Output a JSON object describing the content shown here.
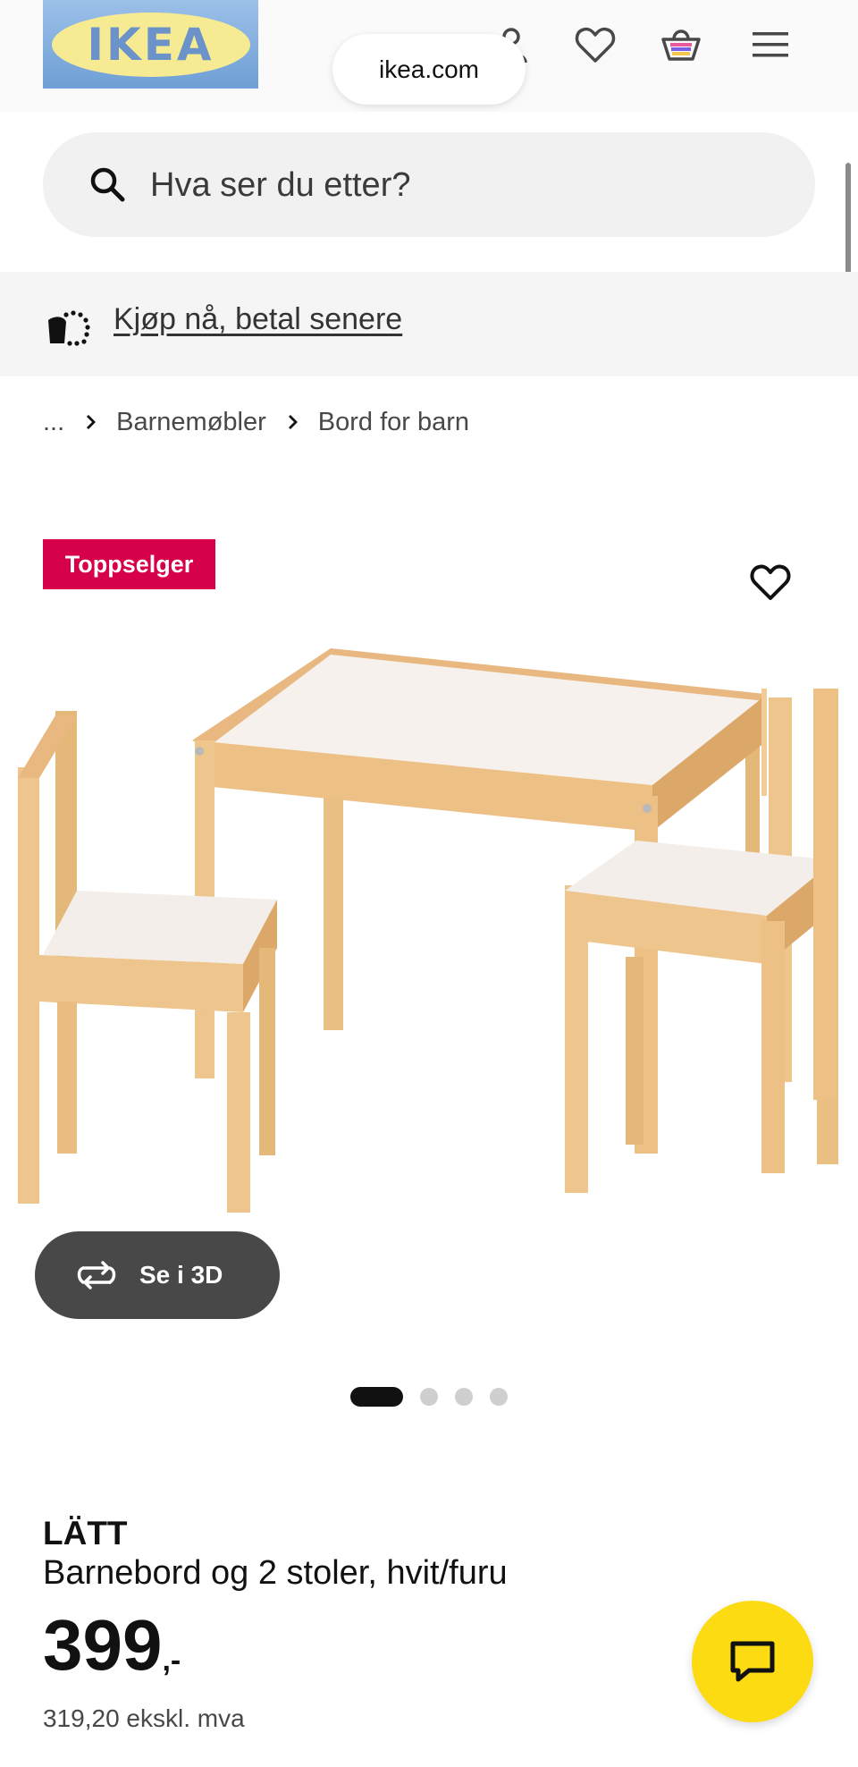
{
  "header": {
    "logo_text": "IKEA",
    "url_tooltip": "ikea.com",
    "icons": [
      "user-icon",
      "heart-icon",
      "basket-icon",
      "menu-icon"
    ]
  },
  "search": {
    "placeholder": "Hva ser du etter?"
  },
  "promo": {
    "icon": "payment-icon",
    "link_label": "Kjøp nå, betal senere"
  },
  "breadcrumb": {
    "ellipsis": "...",
    "items": [
      "Barnemøbler",
      "Bord for barn"
    ]
  },
  "product": {
    "badge": "Toppselger",
    "image_icon": "product-image",
    "view_3d_label": "Se i 3D",
    "carousel": {
      "total": 4,
      "active": 1
    },
    "name": "LÄTT",
    "description": "Barnebord og 2 stoler, hvit/furu",
    "price": "399",
    "price_suffix": ",-",
    "price_excl_vat": "319,20 ekskl. mva"
  },
  "colors": {
    "badge": "#d6004b",
    "chat": "#fcdb12",
    "button_3d": "#484848",
    "logo_blue": "#6f9fd6",
    "logo_yellow": "#f6ea93"
  }
}
